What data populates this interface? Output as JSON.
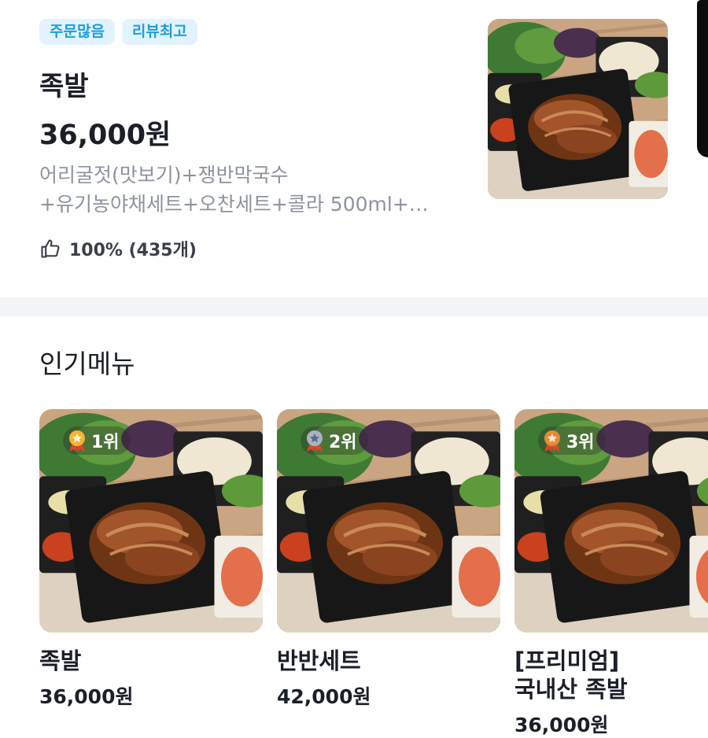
{
  "featured": {
    "badges": [
      "주문많음",
      "리뷰최고"
    ],
    "name": "족발",
    "price": "36,000원",
    "description_line1": "어리굴젓(맛보기)+쟁반막국수",
    "description_line2": "+유기농야채세트+오찬세트+콜라 500ml+…",
    "rating": "100% (435개)",
    "icons": {
      "rating": "thumbs-up-icon"
    }
  },
  "popular": {
    "title": "인기메뉴",
    "items": [
      {
        "rank": "1위",
        "medal": "gold-medal-icon",
        "name": "족발",
        "price": "36,000원"
      },
      {
        "rank": "2위",
        "medal": "silver-medal-icon",
        "name": "반반세트",
        "price": "42,000원"
      },
      {
        "rank": "3위",
        "medal": "bronze-medal-icon",
        "name_line1": "[프리미엄]",
        "name_line2": "국내산 족발",
        "price": "36,000원"
      }
    ]
  },
  "colors": {
    "badge_bg": "#e3f3fd",
    "badge_text": "#1c9ee0",
    "description": "#8d939d"
  }
}
